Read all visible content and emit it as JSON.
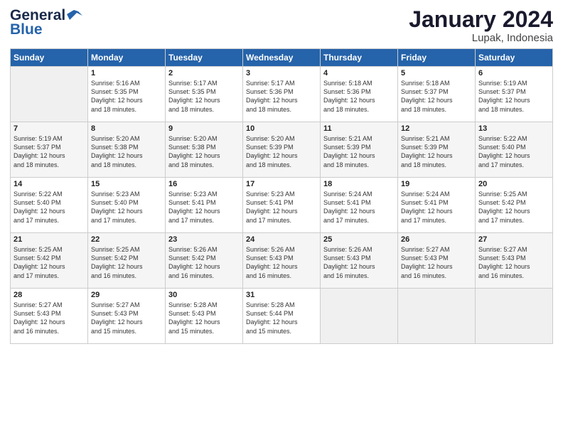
{
  "header": {
    "logo_line1": "General",
    "logo_line2": "Blue",
    "month_year": "January 2024",
    "location": "Lupak, Indonesia"
  },
  "days_of_week": [
    "Sunday",
    "Monday",
    "Tuesday",
    "Wednesday",
    "Thursday",
    "Friday",
    "Saturday"
  ],
  "weeks": [
    [
      {
        "num": "",
        "info": ""
      },
      {
        "num": "1",
        "info": "Sunrise: 5:16 AM\nSunset: 5:35 PM\nDaylight: 12 hours\nand 18 minutes."
      },
      {
        "num": "2",
        "info": "Sunrise: 5:17 AM\nSunset: 5:35 PM\nDaylight: 12 hours\nand 18 minutes."
      },
      {
        "num": "3",
        "info": "Sunrise: 5:17 AM\nSunset: 5:36 PM\nDaylight: 12 hours\nand 18 minutes."
      },
      {
        "num": "4",
        "info": "Sunrise: 5:18 AM\nSunset: 5:36 PM\nDaylight: 12 hours\nand 18 minutes."
      },
      {
        "num": "5",
        "info": "Sunrise: 5:18 AM\nSunset: 5:37 PM\nDaylight: 12 hours\nand 18 minutes."
      },
      {
        "num": "6",
        "info": "Sunrise: 5:19 AM\nSunset: 5:37 PM\nDaylight: 12 hours\nand 18 minutes."
      }
    ],
    [
      {
        "num": "7",
        "info": "Sunrise: 5:19 AM\nSunset: 5:37 PM\nDaylight: 12 hours\nand 18 minutes."
      },
      {
        "num": "8",
        "info": "Sunrise: 5:20 AM\nSunset: 5:38 PM\nDaylight: 12 hours\nand 18 minutes."
      },
      {
        "num": "9",
        "info": "Sunrise: 5:20 AM\nSunset: 5:38 PM\nDaylight: 12 hours\nand 18 minutes."
      },
      {
        "num": "10",
        "info": "Sunrise: 5:20 AM\nSunset: 5:39 PM\nDaylight: 12 hours\nand 18 minutes."
      },
      {
        "num": "11",
        "info": "Sunrise: 5:21 AM\nSunset: 5:39 PM\nDaylight: 12 hours\nand 18 minutes."
      },
      {
        "num": "12",
        "info": "Sunrise: 5:21 AM\nSunset: 5:39 PM\nDaylight: 12 hours\nand 18 minutes."
      },
      {
        "num": "13",
        "info": "Sunrise: 5:22 AM\nSunset: 5:40 PM\nDaylight: 12 hours\nand 17 minutes."
      }
    ],
    [
      {
        "num": "14",
        "info": "Sunrise: 5:22 AM\nSunset: 5:40 PM\nDaylight: 12 hours\nand 17 minutes."
      },
      {
        "num": "15",
        "info": "Sunrise: 5:23 AM\nSunset: 5:40 PM\nDaylight: 12 hours\nand 17 minutes."
      },
      {
        "num": "16",
        "info": "Sunrise: 5:23 AM\nSunset: 5:41 PM\nDaylight: 12 hours\nand 17 minutes."
      },
      {
        "num": "17",
        "info": "Sunrise: 5:23 AM\nSunset: 5:41 PM\nDaylight: 12 hours\nand 17 minutes."
      },
      {
        "num": "18",
        "info": "Sunrise: 5:24 AM\nSunset: 5:41 PM\nDaylight: 12 hours\nand 17 minutes."
      },
      {
        "num": "19",
        "info": "Sunrise: 5:24 AM\nSunset: 5:41 PM\nDaylight: 12 hours\nand 17 minutes."
      },
      {
        "num": "20",
        "info": "Sunrise: 5:25 AM\nSunset: 5:42 PM\nDaylight: 12 hours\nand 17 minutes."
      }
    ],
    [
      {
        "num": "21",
        "info": "Sunrise: 5:25 AM\nSunset: 5:42 PM\nDaylight: 12 hours\nand 17 minutes."
      },
      {
        "num": "22",
        "info": "Sunrise: 5:25 AM\nSunset: 5:42 PM\nDaylight: 12 hours\nand 16 minutes."
      },
      {
        "num": "23",
        "info": "Sunrise: 5:26 AM\nSunset: 5:42 PM\nDaylight: 12 hours\nand 16 minutes."
      },
      {
        "num": "24",
        "info": "Sunrise: 5:26 AM\nSunset: 5:43 PM\nDaylight: 12 hours\nand 16 minutes."
      },
      {
        "num": "25",
        "info": "Sunrise: 5:26 AM\nSunset: 5:43 PM\nDaylight: 12 hours\nand 16 minutes."
      },
      {
        "num": "26",
        "info": "Sunrise: 5:27 AM\nSunset: 5:43 PM\nDaylight: 12 hours\nand 16 minutes."
      },
      {
        "num": "27",
        "info": "Sunrise: 5:27 AM\nSunset: 5:43 PM\nDaylight: 12 hours\nand 16 minutes."
      }
    ],
    [
      {
        "num": "28",
        "info": "Sunrise: 5:27 AM\nSunset: 5:43 PM\nDaylight: 12 hours\nand 16 minutes."
      },
      {
        "num": "29",
        "info": "Sunrise: 5:27 AM\nSunset: 5:43 PM\nDaylight: 12 hours\nand 15 minutes."
      },
      {
        "num": "30",
        "info": "Sunrise: 5:28 AM\nSunset: 5:43 PM\nDaylight: 12 hours\nand 15 minutes."
      },
      {
        "num": "31",
        "info": "Sunrise: 5:28 AM\nSunset: 5:44 PM\nDaylight: 12 hours\nand 15 minutes."
      },
      {
        "num": "",
        "info": ""
      },
      {
        "num": "",
        "info": ""
      },
      {
        "num": "",
        "info": ""
      }
    ]
  ]
}
